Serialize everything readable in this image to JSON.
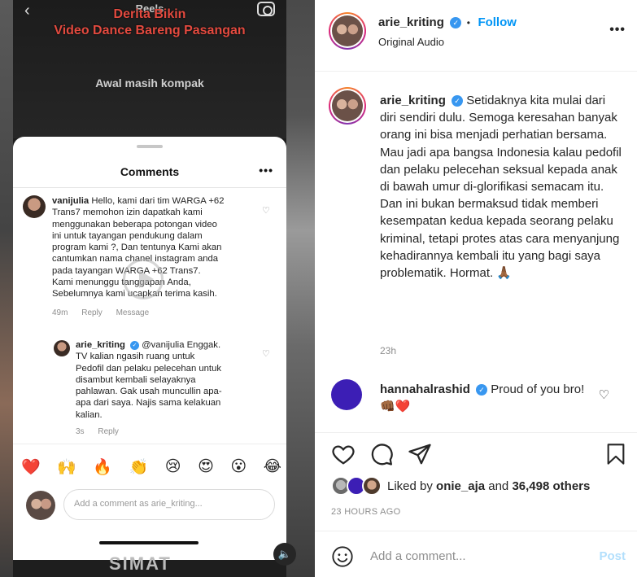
{
  "video": {
    "top_label": "Reels",
    "caption_line1": "Derita Bikin",
    "caption_line2": "Video Dance Bareng Pasangan",
    "caption_sub": "Awal masih kompak",
    "comments_sheet": {
      "title": "Comments",
      "comments": [
        {
          "username": "vanijulia",
          "lines": [
            "Hello, kami dari tim WARGA +62",
            "Trans7 memohon izin dapatkah kami",
            "menggunakan beberapa potongan video",
            "ini  untuk tayangan pendukung dalam",
            "program kami ?, Dan tentunya Kami akan",
            "cantumkan nama chanel instagram  anda",
            "pada tayangan WARGA +62  Trans7.",
            "Kami menunggu tanggapan Anda,",
            "Sebelumnya kami ucapkan terima kasih."
          ],
          "time": "49m",
          "reply": "Reply",
          "message": "Message"
        },
        {
          "username": "arie_kriting",
          "mention": "@vanijulia",
          "lines_first": "Enggak.",
          "lines": [
            "TV kalian ngasih ruang untuk",
            "Pedofil dan pelaku pelecehan untuk",
            "disambut kembali selayaknya",
            "pahlawan. Gak usah muncullin apa-",
            "apa dari saya. Najis sama kelakuan",
            "kalian."
          ],
          "time": "3s",
          "reply": "Reply"
        }
      ],
      "emojis": [
        "❤️",
        "🙌",
        "🔥",
        "👏",
        "😢",
        "😍",
        "😮",
        "😂"
      ],
      "input_placeholder": "Add a comment as arie_kriting..."
    },
    "shirt_text": "SIMAT"
  },
  "header": {
    "username": "arie_kriting",
    "follow_label": "Follow",
    "separator": "•",
    "audio": "Original Audio",
    "more": "•••"
  },
  "caption": {
    "username": "arie_kriting",
    "text": "Setidaknya kita mulai dari diri sendiri dulu. Semoga keresahan banyak orang ini bisa menjadi perhatian bersama. Mau jadi apa bangsa Indonesia kalau pedofil dan pelaku pelecehan seksual kepada anak di bawah umur di-glorifikasi semacam itu. Dan ini bukan bermaksud tidak memberi kesempatan kedua kepada seorang pelaku kriminal, tetapi protes atas cara menyanjung kehadirannya kembali itu yang bagi saya problematik. Hormat. 🙏🏾",
    "time": "23h"
  },
  "comment": {
    "username": "hannahalrashid",
    "text": "Proud of you bro! 👊🏾❤️"
  },
  "likes": {
    "prefix": "Liked by",
    "user": "onie_aja",
    "and": "and",
    "count": "36,498 others"
  },
  "timestamp": "23 HOURS AGO",
  "add_comment": {
    "placeholder": "Add a comment...",
    "post": "Post"
  },
  "colors": {
    "accent": "#0095f6",
    "verified": "#3897f0",
    "post_disabled": "#b2dffc"
  }
}
